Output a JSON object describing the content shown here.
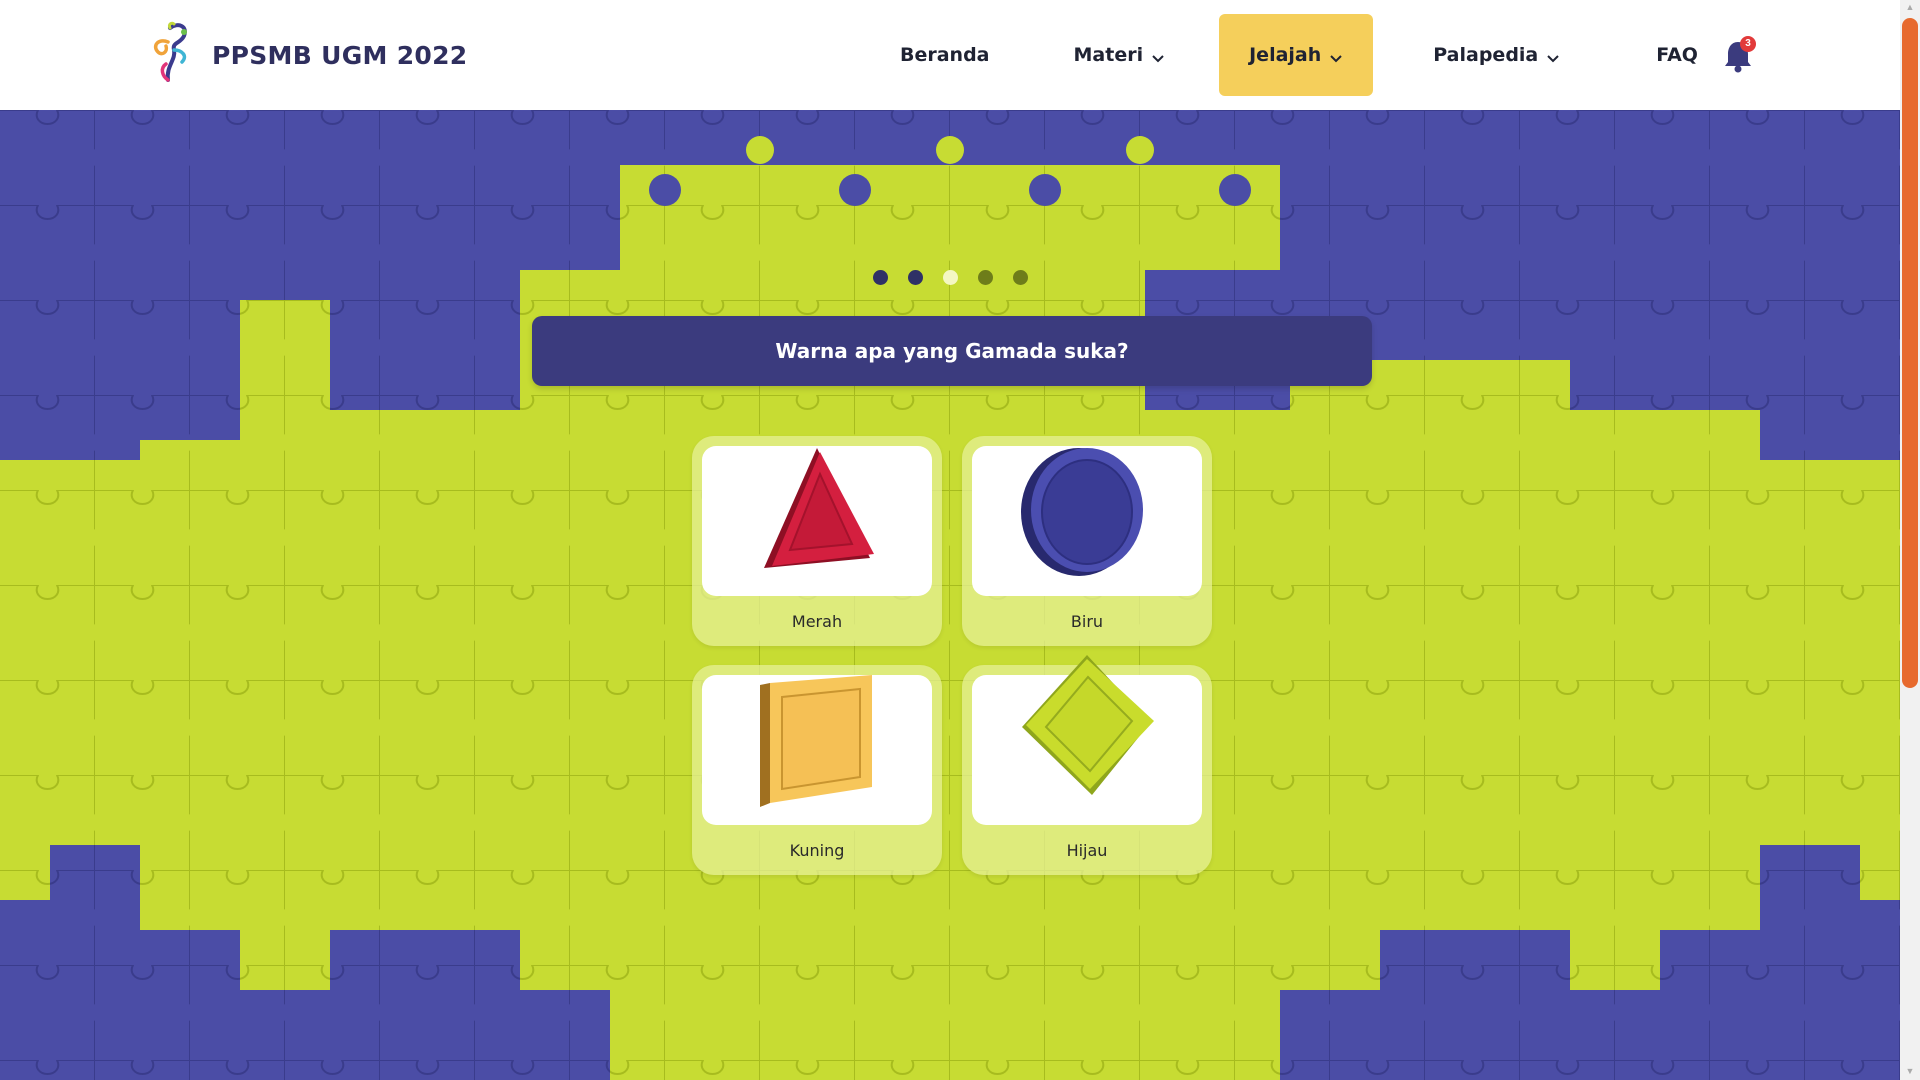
{
  "brand": {
    "title": "PPSMB UGM 2022",
    "logo_icon": "ppsmb-logo-icon"
  },
  "nav": {
    "items": [
      {
        "label": "Beranda",
        "has_dropdown": false
      },
      {
        "label": "Materi",
        "has_dropdown": true
      },
      {
        "label": "Jelajah",
        "has_dropdown": true,
        "active": true
      },
      {
        "label": "Palapedia",
        "has_dropdown": true
      },
      {
        "label": "FAQ",
        "has_dropdown": false
      }
    ],
    "notification": {
      "icon": "bell-icon",
      "count": "3"
    }
  },
  "quiz": {
    "question": "Warna apa yang Gamada suka?",
    "progress_dots": [
      {
        "state": "done"
      },
      {
        "state": "done"
      },
      {
        "state": "current"
      },
      {
        "state": "pending"
      },
      {
        "state": "pending"
      }
    ],
    "options": [
      {
        "label": "Merah",
        "shape": "triangle-icon"
      },
      {
        "label": "Biru",
        "shape": "circle-icon"
      },
      {
        "label": "Kuning",
        "shape": "square-icon"
      },
      {
        "label": "Hijau",
        "shape": "diamond-icon"
      }
    ]
  },
  "colors": {
    "header_bg": "#ffffff",
    "brand_text": "#2f2f5e",
    "active_nav": "#f5cf5b",
    "puzzle_green": "#c7dc33",
    "puzzle_blue": "#4b4da6",
    "question_bg": "#3b3b7e",
    "scrollbar": "#e76a2e",
    "red": "#d41f3f",
    "blue": "#3a3c95",
    "yellow": "#f7c65a",
    "green": "#c9dc2c"
  }
}
